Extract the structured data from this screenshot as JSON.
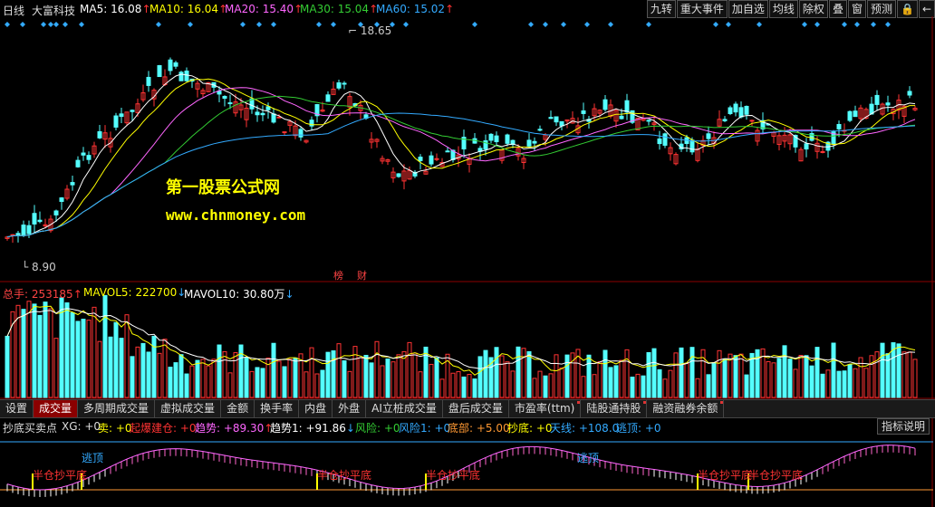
{
  "header": {
    "period": "日线",
    "stock_name": "大富科技",
    "ma5": {
      "label": "MA5:",
      "value": "16.08",
      "arrow": "↑",
      "color": "#ffffff"
    },
    "ma10": {
      "label": "MA10:",
      "value": "16.04",
      "arrow": "↑",
      "color": "#ffff00"
    },
    "ma20": {
      "label": "MA20:",
      "value": "15.40",
      "arrow": "↑",
      "color": "#ff66ff"
    },
    "ma30": {
      "label": "MA30:",
      "value": "15.04",
      "arrow": "↑",
      "color": "#33cc33"
    },
    "ma60": {
      "label": "MA60:",
      "value": "15.02",
      "arrow": "↑",
      "color": "#33aaff"
    }
  },
  "toolbar": [
    "九转",
    "重大事件",
    "加自选",
    "均线",
    "除权",
    "叠",
    "窗",
    "预测",
    "lock-icon",
    "left-arrow-icon"
  ],
  "price_chart": {
    "high_label": "18.65",
    "low_label": "8.90",
    "event_tags": [
      "榜",
      "财"
    ]
  },
  "watermark": {
    "line1": "第一股票公式网",
    "line2": "www.chnmoney.com"
  },
  "volume": {
    "total_label": "总手:",
    "total_value": "253185",
    "total_arrow": "↑",
    "mavol5_label": "MAVOL5:",
    "mavol5_value": "222700",
    "mavol5_arrow": "↓",
    "mavol10_label": "MAVOL10:",
    "mavol10_value": "30.80万",
    "mavol10_arrow": "↓"
  },
  "tabs": [
    "设置",
    "成交量",
    "多周期成交量",
    "虚拟成交量",
    "金额",
    "换手率",
    "内盘",
    "外盘",
    "AI立桩成交量",
    "盘后成交量",
    "市盈率(ttm)",
    "陆股通持股",
    "融资融券余额"
  ],
  "active_tab": "成交量",
  "indicator": {
    "name": "抄底买卖点",
    "xg": "XG: +0",
    "sell": "卖: +0",
    "boom": "起爆建仓: +0",
    "trend": "趋势: +89.30",
    "trend_arrow": "↑",
    "trend1": "趋势1: +91.86",
    "trend1_arrow": "↓",
    "risk": "风险: +0",
    "risk1": "风险1: +0",
    "bottom": "底部: +5.00",
    "chaodi": "抄底: +0",
    "tianxian": "天线: +108.0",
    "taoding": "逃顶: +0",
    "help": "指标说明",
    "labels_escape": "逃顶",
    "labels_half": "半仓抄平底"
  },
  "colors": {
    "up": "#ff3333",
    "down": "#54ffff",
    "bg": "#000000",
    "grid": "#8b0000"
  }
}
